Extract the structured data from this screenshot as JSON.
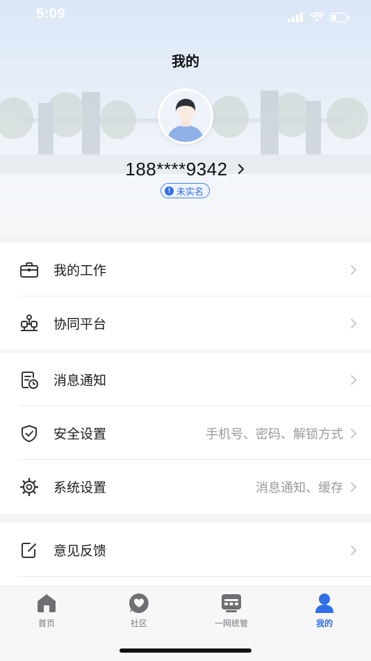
{
  "status_bar": {
    "time": "5:09"
  },
  "header": {
    "title": "我的",
    "phone": "188****9342",
    "badge": "未实名"
  },
  "menu_groups": [
    {
      "items": [
        {
          "icon": "briefcase-icon",
          "label": "我的工作",
          "value": ""
        },
        {
          "icon": "collaboration-icon",
          "label": "协同平台",
          "value": ""
        }
      ]
    },
    {
      "items": [
        {
          "icon": "message-notification-icon",
          "label": "消息通知",
          "value": ""
        },
        {
          "icon": "shield-check-icon",
          "label": "安全设置",
          "value": "手机号、密码、解锁方式"
        },
        {
          "icon": "gear-icon",
          "label": "系统设置",
          "value": "消息通知、缓存"
        }
      ]
    },
    {
      "items": [
        {
          "icon": "feedback-edit-icon",
          "label": "意见反馈",
          "value": ""
        }
      ]
    }
  ],
  "tabbar": [
    {
      "icon": "home-icon",
      "label": "首页",
      "active": false
    },
    {
      "icon": "community-heart-icon",
      "label": "社区",
      "active": false
    },
    {
      "icon": "unified-management-icon",
      "label": "一网统管",
      "active": false
    },
    {
      "icon": "profile-icon",
      "label": "我的",
      "active": true
    }
  ],
  "colors": {
    "accent": "#2f6fe8",
    "inactive": "#7a7a7e"
  }
}
